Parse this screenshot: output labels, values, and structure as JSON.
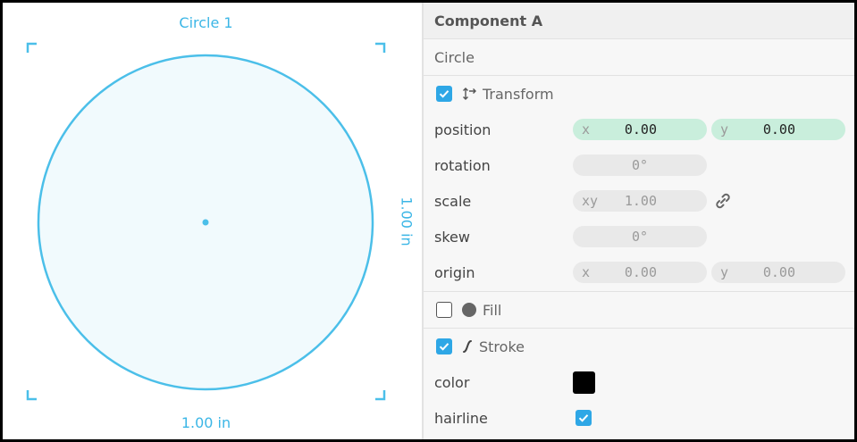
{
  "canvas": {
    "title": "Circle 1",
    "width_label": "1.00 in",
    "height_label": "1.00 in",
    "stroke_color": "#4bbfe9",
    "fill_color": "#f1fafd"
  },
  "panel": {
    "component_title": "Component A",
    "object_name": "Circle",
    "transform": {
      "label": "Transform",
      "enabled": true,
      "position": {
        "label": "position",
        "x_prefix": "x",
        "x_value": "0.00",
        "y_prefix": "y",
        "y_value": "0.00"
      },
      "rotation": {
        "label": "rotation",
        "value": "0°"
      },
      "scale": {
        "label": "scale",
        "prefix": "xy",
        "value": "1.00"
      },
      "skew": {
        "label": "skew",
        "value": "0°"
      },
      "origin": {
        "label": "origin",
        "x_prefix": "x",
        "x_value": "0.00",
        "y_prefix": "y",
        "y_value": "0.00"
      }
    },
    "fill": {
      "label": "Fill",
      "enabled": false
    },
    "stroke": {
      "label": "Stroke",
      "enabled": true,
      "color": {
        "label": "color",
        "value": "#000000"
      },
      "hairline": {
        "label": "hairline",
        "enabled": true
      }
    }
  },
  "icons": {
    "transform": "transform-arrows-icon",
    "fill": "filled-circle-icon",
    "stroke": "stroke-curve-icon",
    "scale_link": "link-icon"
  }
}
